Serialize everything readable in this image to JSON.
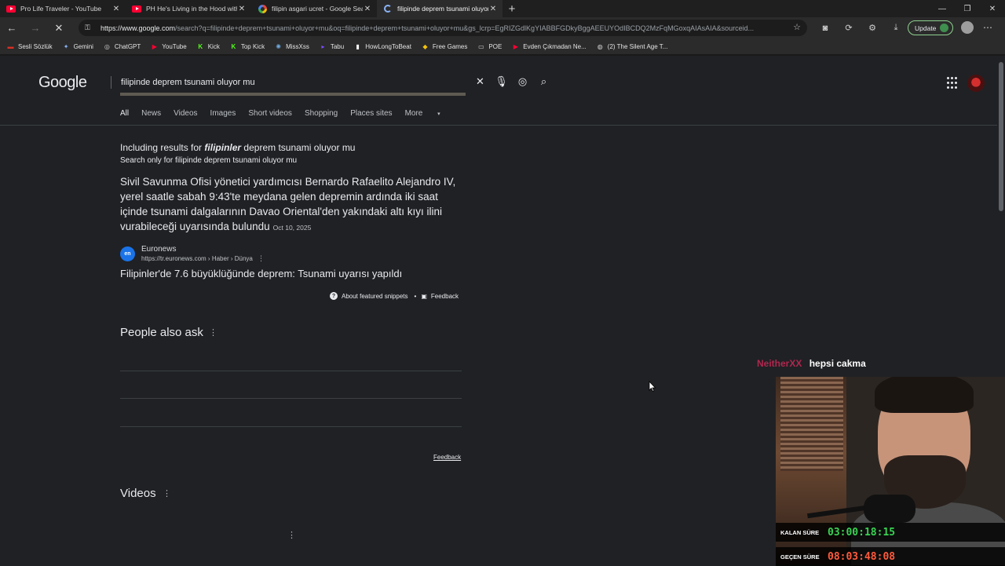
{
  "browser": {
    "tabs": [
      {
        "title": "Pro Life Traveler - YouTube",
        "icon": "youtube-icon",
        "active": false
      },
      {
        "title": "PH He's Living in the Hood with a",
        "icon": "youtube-icon",
        "active": false
      },
      {
        "title": "filipin asgari ucret - Google Searc",
        "icon": "google-icon",
        "active": false
      },
      {
        "title": "filipinde deprem tsunami oluyor n",
        "icon": "loading-icon",
        "active": true
      }
    ],
    "new_tab": "+",
    "url_host": "https://www.google.com",
    "url_rest": "/search?q=filipinde+deprem+tsunami+oluyor+mu&oq=filipinde+deprem+tsunami+oluyor+mu&gs_lcrp=EgRIZGdlKgYIABBFGDkyBggAEEUYOdIBCDQ2MzFqMGoxqAIAsAIA&sourceid...",
    "update_label": "Update",
    "bookmarks": [
      {
        "label": "Sesli Sözlük",
        "icon": "sesli-icon",
        "color": "#d93025"
      },
      {
        "label": "Gemini",
        "icon": "gemini-icon",
        "color": "#8ab4f8"
      },
      {
        "label": "ChatGPT",
        "icon": "chatgpt-icon",
        "color": "#cccccc"
      },
      {
        "label": "YouTube",
        "icon": "youtube-icon",
        "color": "#ff0033"
      },
      {
        "label": "Kick",
        "icon": "kick-icon",
        "color": "#53fc18"
      },
      {
        "label": "Top Kick",
        "icon": "kick-icon",
        "color": "#53fc18"
      },
      {
        "label": "MissXss",
        "icon": "missxss-icon",
        "color": "#6fa8dc"
      },
      {
        "label": "Tabu",
        "icon": "tabu-icon",
        "color": "#7c4dff"
      },
      {
        "label": "HowLongToBeat",
        "icon": "hltb-icon",
        "color": "#ffffff"
      },
      {
        "label": "Free Games",
        "icon": "free-games-icon",
        "color": "#f4c20d"
      },
      {
        "label": "POE",
        "icon": "folder-icon",
        "color": "#cfcfcf"
      },
      {
        "label": "Evden Çıkmadan Ne...",
        "icon": "youtube-icon",
        "color": "#ff0033"
      },
      {
        "label": "(2) The Silent Age T...",
        "icon": "globe-icon",
        "color": "#cfcfcf"
      }
    ]
  },
  "google": {
    "logo": "Google",
    "query": "filipinde deprem tsunami oluyor mu",
    "nav_tabs": [
      "All",
      "News",
      "Videos",
      "Images",
      "Short videos",
      "Shopping",
      "Places sites",
      "More"
    ],
    "including_prefix": "Including results for",
    "including_bold": "filipinler",
    "including_rest": "deprem tsunami oluyor mu",
    "search_only": "Search only for filipinde deprem tsunami oluyor mu",
    "snippet_text": "Sivil Savunma Ofisi yönetici yardımcısı Bernardo Rafaelito Alejandro IV, yerel saatle sabah 9:43'te meydana gelen depremin ardında iki saat içinde tsunami dalgalarının Davao Oriental'den yakındaki altı kıyı ilini vurabileceği uyarısında bulundu",
    "snippet_date": "Oct 10, 2025",
    "source_icon_text": "en",
    "source_name": "Euronews",
    "source_url": "https://tr.euronews.com › Haber › Dünya",
    "result_title": "Filipinler'de 7.6 büyüklüğünde deprem: Tsunami uyarısı yapıldı",
    "about_snippets": "About featured snippets",
    "feedback": "Feedback",
    "people_also_ask": "People also ask",
    "feedback2": "Feedback",
    "videos_heading": "Videos"
  },
  "stream": {
    "chat_user": "NeitherXX",
    "chat_message": "hepsi cakma",
    "remaining_label": "KALAN SÜRE",
    "remaining_value": "03:00:18:15",
    "remaining_color": "#39d353",
    "elapsed_label": "GEÇEN SÜRE",
    "elapsed_value": "08:03:48:08",
    "elapsed_color": "#ff5a3c"
  }
}
